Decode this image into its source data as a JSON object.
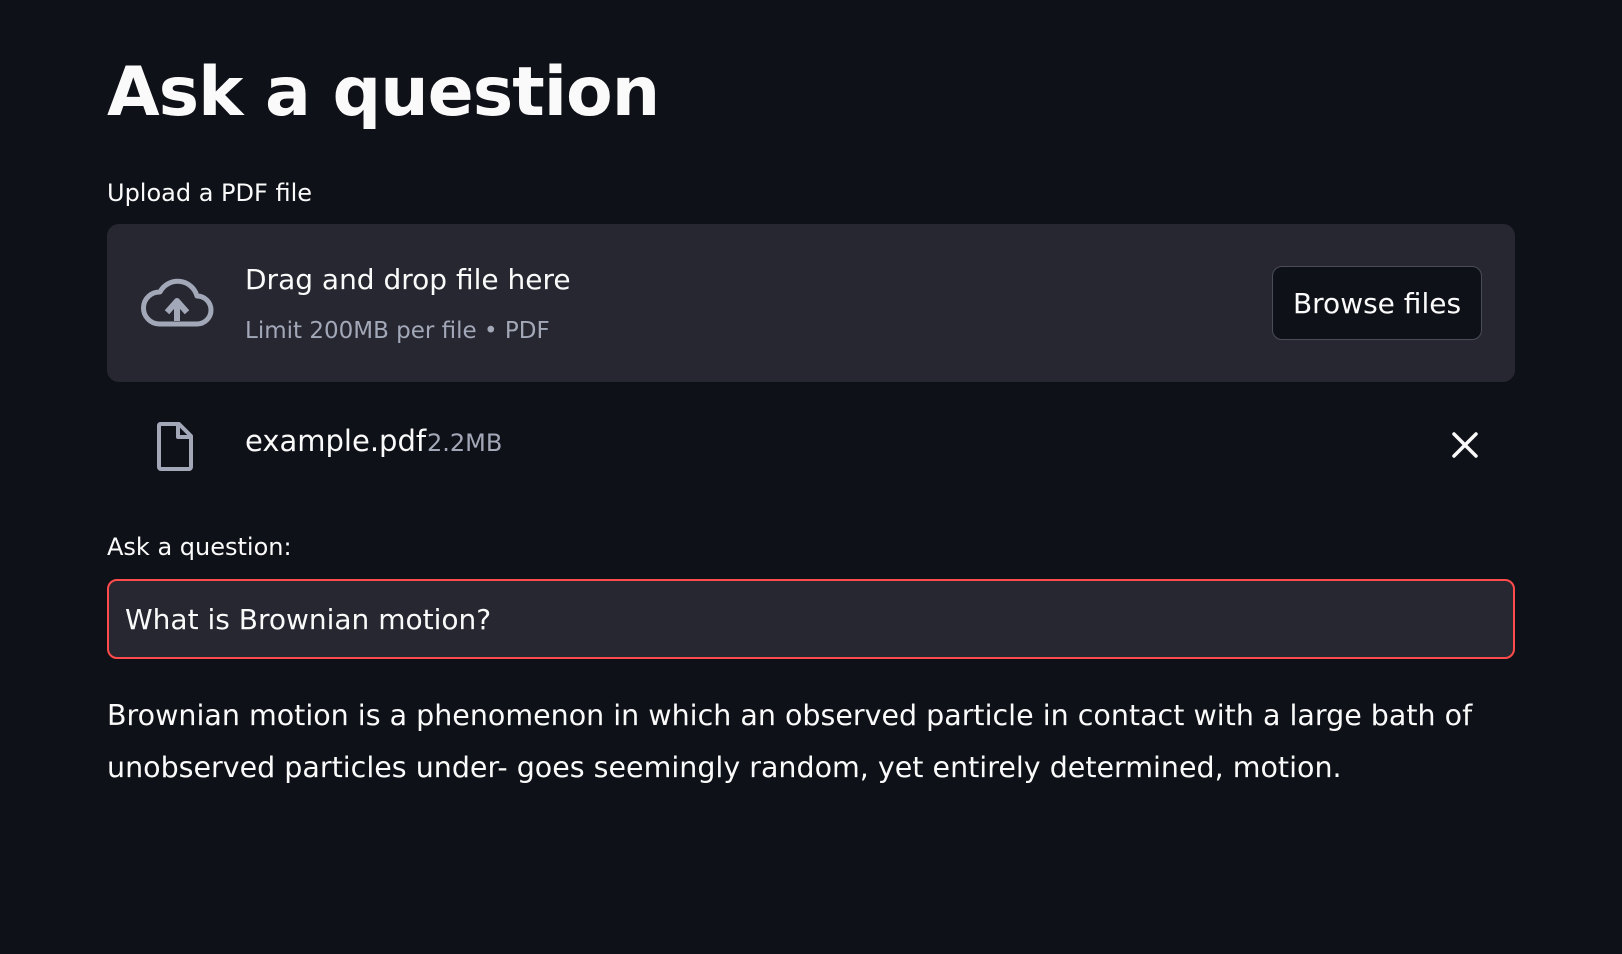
{
  "page": {
    "title": "Ask a question"
  },
  "uploader": {
    "label": "Upload a PDF file",
    "drop_title": "Drag and drop file here",
    "drop_subtitle": "Limit 200MB per file • PDF",
    "browse_label": "Browse files",
    "icon": "cloud-upload-icon"
  },
  "uploaded_file": {
    "name": "example.pdf",
    "size": "2.2MB",
    "icon": "file-icon",
    "remove_icon": "close-icon"
  },
  "question": {
    "label": "Ask a question:",
    "value": "What is Brownian motion?"
  },
  "answer": {
    "text": "Brownian motion is a phenomenon in which an observed particle in contact with a large bath of unobserved particles under- goes seemingly random, yet entirely determined, motion."
  },
  "colors": {
    "background": "#0e1117",
    "surface": "#262730",
    "text": "#fafafa",
    "muted": "#a3a8b8",
    "focus_border": "#ff4b4b"
  }
}
